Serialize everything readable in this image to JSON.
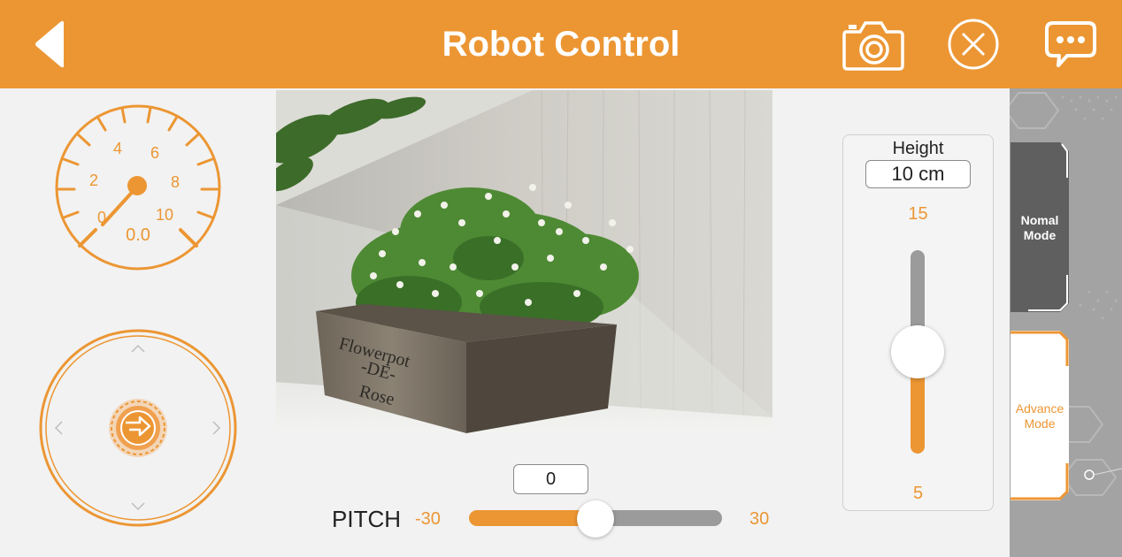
{
  "header": {
    "title": "Robot Control",
    "icons": [
      "back-arrow-icon",
      "camera-icon",
      "close-circle-icon",
      "chat-bubble-icon"
    ]
  },
  "speed_gauge": {
    "tick_labels": [
      "0",
      "2",
      "4",
      "6",
      "8",
      "10"
    ],
    "value": "0.0"
  },
  "joystick": {
    "icons": [
      "arrow-up-icon",
      "arrow-down-icon",
      "arrow-left-icon",
      "arrow-right-icon",
      "joystick-knob-icon"
    ]
  },
  "pitch": {
    "label": "PITCH",
    "min": "-30",
    "max": "30",
    "value": "0"
  },
  "height": {
    "title": "Height",
    "value": "10 cm",
    "max": "15",
    "min": "5",
    "level": 10
  },
  "modes": {
    "normal_label_1": "Nomal",
    "normal_label_2": "Mode",
    "advance_label_1": "Advance",
    "advance_label_2": "Mode",
    "selected": "Advance Mode"
  },
  "colors": {
    "accent": "#ec9633",
    "track_inactive": "#9b9b9b",
    "mode_dark": "#5f5f5f",
    "side_panel": "#9a9a9a"
  }
}
